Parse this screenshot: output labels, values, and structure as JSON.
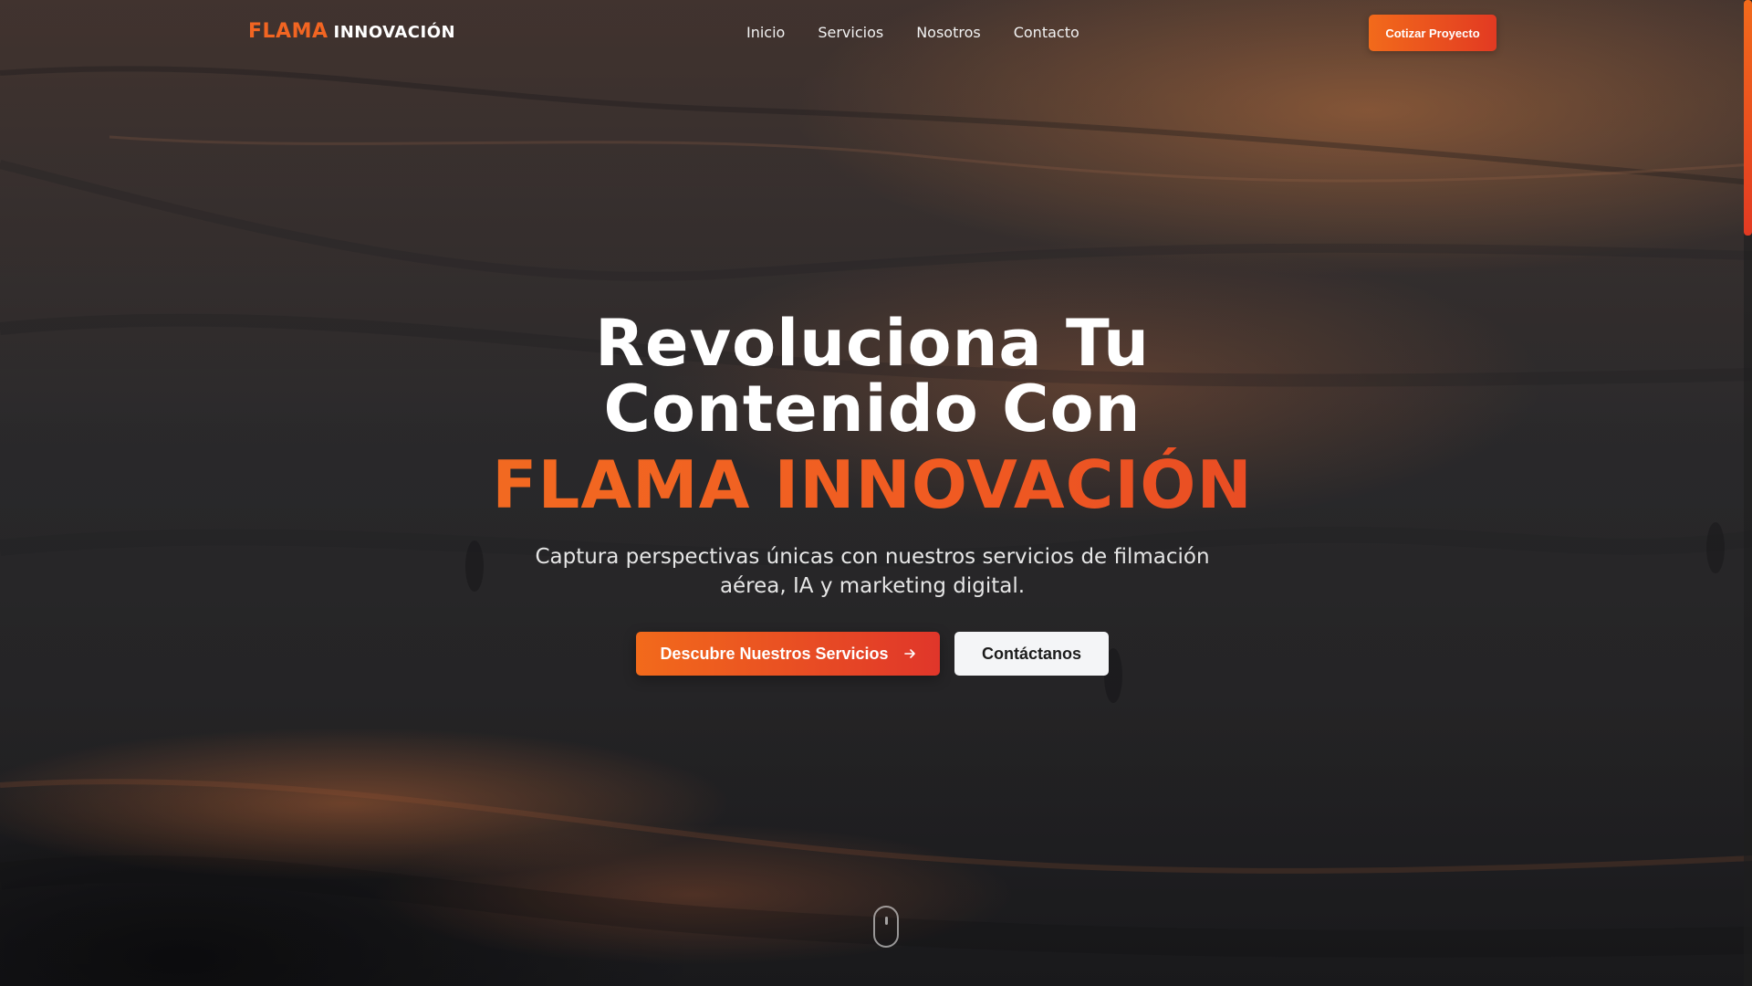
{
  "nav": {
    "logo_brand": "FLAMA",
    "logo_sub": "INNOVACIÓN",
    "links": [
      "Inicio",
      "Servicios",
      "Nosotros",
      "Contacto"
    ],
    "cta_label": "Cotizar Proyecto"
  },
  "hero": {
    "headline_line1": "Revoluciona Tu",
    "headline_line2": "Contenido Con",
    "headline_accent": "FLAMA INNOVACIÓN",
    "subtitle": "Captura perspectivas únicas con nuestros servicios de filmación aérea, IA y marketing digital.",
    "primary_button": "Descubre Nuestros Servicios",
    "primary_button_icon": "arrow-right-icon",
    "secondary_button": "Contáctanos",
    "scroll_icon": "mouse-scroll-icon"
  },
  "colors": {
    "accent": "#f26522",
    "accent_dark": "#e23a22",
    "secondary_button_bg": "#f4f5f7"
  }
}
